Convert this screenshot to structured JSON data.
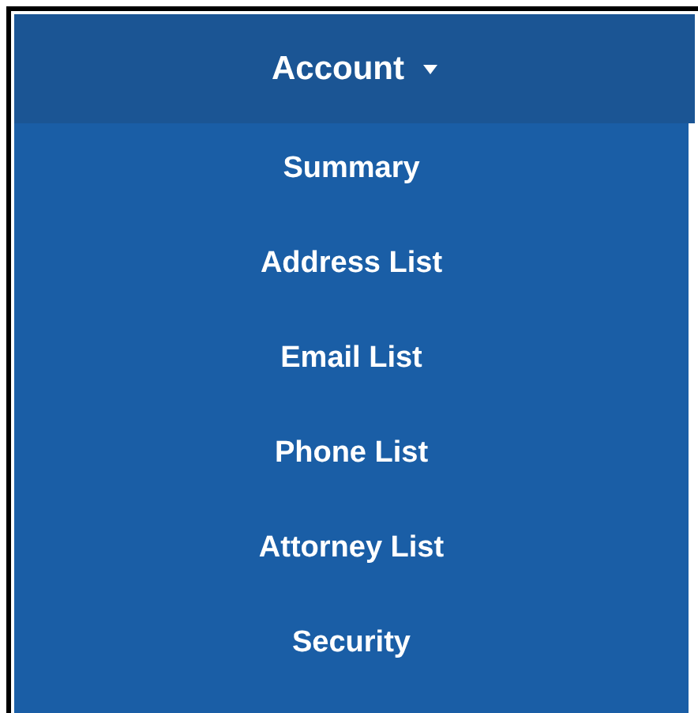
{
  "menu": {
    "title": "Account",
    "items": [
      {
        "label": "Summary"
      },
      {
        "label": "Address List"
      },
      {
        "label": "Email List"
      },
      {
        "label": "Phone List"
      },
      {
        "label": "Attorney List"
      },
      {
        "label": "Security"
      }
    ]
  }
}
